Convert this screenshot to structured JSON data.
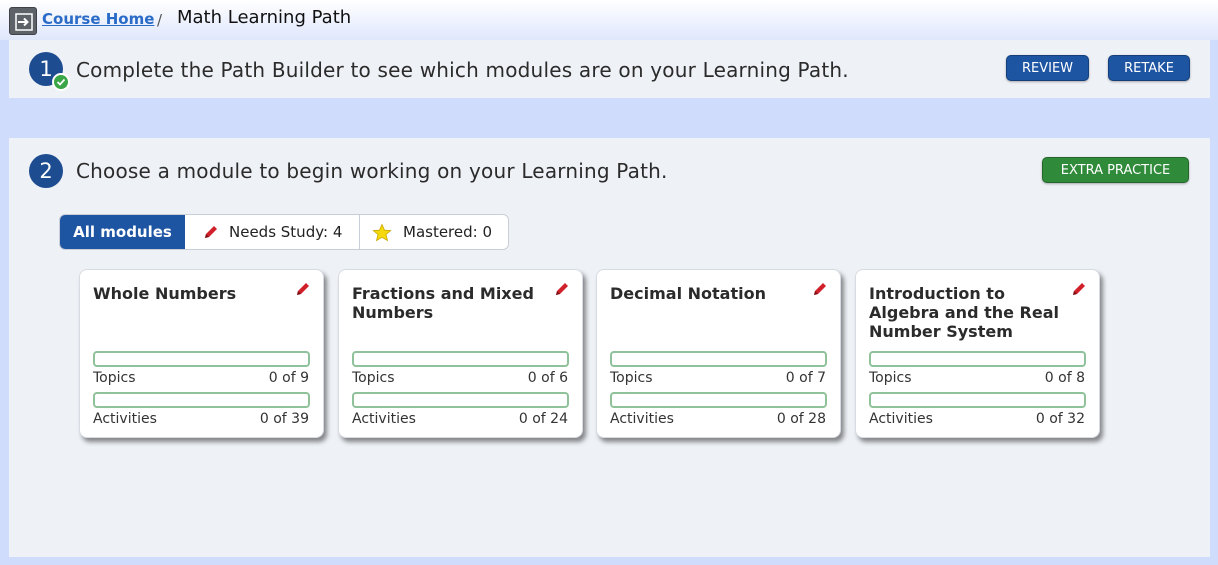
{
  "breadcrumb": {
    "home_link": "Course Home",
    "separator": "/",
    "title": "Math Learning Path"
  },
  "step1": {
    "number": "1",
    "text": "Complete the Path Builder to see which modules are on your Learning Path.",
    "review_label": "REVIEW",
    "retake_label": "RETAKE"
  },
  "step2": {
    "number": "2",
    "text": "Choose a module to begin working on your Learning Path.",
    "extra_practice_label": "EXTRA PRACTICE"
  },
  "filters": {
    "all": "All modules",
    "needs_study": "Needs Study: 4",
    "mastered": "Mastered: 0"
  },
  "modules": [
    {
      "title": "Whole Numbers",
      "topics_label": "Topics",
      "topics_value": "0 of 9",
      "topics_progress": 0,
      "activities_label": "Activities",
      "activities_value": "0 of 39",
      "activities_progress": 0
    },
    {
      "title": "Fractions and Mixed Numbers",
      "topics_label": "Topics",
      "topics_value": "0 of 6",
      "topics_progress": 0,
      "activities_label": "Activities",
      "activities_value": "0 of 24",
      "activities_progress": 0
    },
    {
      "title": "Decimal Notation",
      "topics_label": "Topics",
      "topics_value": "0 of 7",
      "topics_progress": 0,
      "activities_label": "Activities",
      "activities_value": "0 of 28",
      "activities_progress": 0
    },
    {
      "title": "Introduction to Algebra and the Real Number System",
      "topics_label": "Topics",
      "topics_value": "0 of 8",
      "topics_progress": 0,
      "activities_label": "Activities",
      "activities_value": "0 of 32",
      "activities_progress": 0
    }
  ],
  "icons": {
    "home": "exit-arrow-icon",
    "check": "check-icon",
    "pencil": "pencil-icon",
    "star": "star-icon"
  },
  "colors": {
    "primary": "#1d55a3",
    "success": "#2f8a3a",
    "pencil": "#d0202a",
    "star": "#f5d90a"
  }
}
